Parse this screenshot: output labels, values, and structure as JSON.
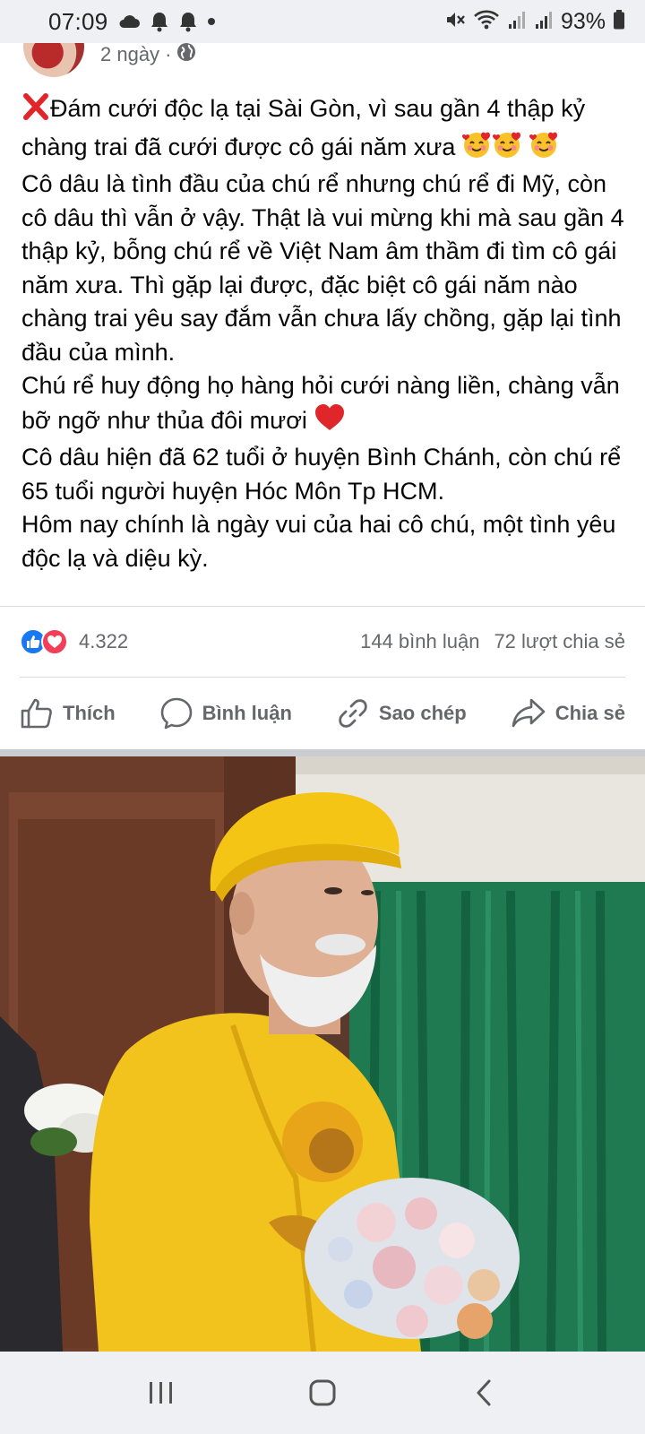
{
  "status_bar": {
    "time": "07:09",
    "battery_percent": "93%",
    "icons_left": [
      "cloud-icon",
      "bell-icon",
      "bell-icon",
      "dot-icon"
    ],
    "icons_right": [
      "mute-icon",
      "wifi-icon",
      "signal-icon",
      "signal-icon",
      "battery-icon"
    ]
  },
  "post": {
    "time": "2 ngày",
    "separator": "·",
    "privacy_icon": "globe-icon",
    "paragraphs": [
      "Đám cưới độc lạ tại Sài Gòn, vì sau gần 4 thập kỷ chàng trai đã cưới được cô gái năm xưa",
      "Cô dâu là tình đầu của chú rể nhưng chú rể đi Mỹ, còn cô dâu thì vẫn ở vậy. Thật là vui mừng khi mà sau gần 4 thập kỷ, bỗng chú rể về Việt Nam âm thầm đi tìm cô gái năm xưa. Thì gặp lại được, đặc biệt cô gái năm nào chàng trai yêu say đắm vẫn chưa lấy chồng, gặp lại tình đầu của mình.",
      "Chú rể huy động họ hàng hỏi cưới nàng liền, chàng vẫn bỡ ngỡ như thủa đôi mươi",
      "Cô dâu hiện đã 62 tuổi ở huyện Bình Chánh, còn chú rể 65 tuổi người huyện Hóc Môn Tp HCM.",
      "Hôm nay chính là ngày vui của hai cô chú, một tình yêu độc lạ và diệu kỳ."
    ]
  },
  "reactions": {
    "count": "4.322",
    "comments": "144 bình luận",
    "shares": "72 lượt chia sẻ"
  },
  "actions": {
    "like": "Thích",
    "comment": "Bình luận",
    "copy": "Sao chép",
    "share": "Chia sẻ"
  },
  "colors": {
    "accent": "#1877f2",
    "love": "#f33e58",
    "secondary_text": "#65676b"
  }
}
